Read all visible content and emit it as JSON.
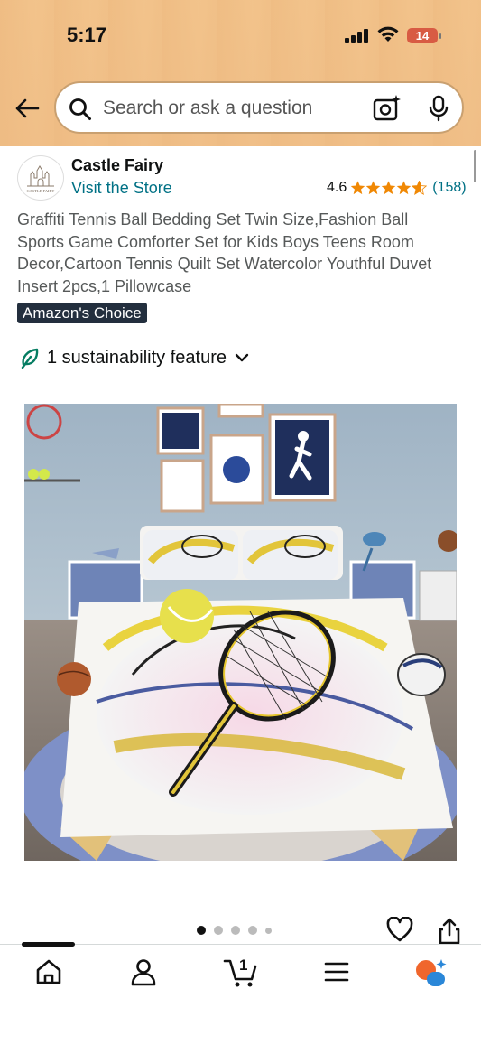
{
  "status_bar": {
    "time": "5:17",
    "battery": "14"
  },
  "search": {
    "placeholder": "Search or ask a question"
  },
  "store": {
    "name": "Castle Fairy",
    "visit_label": "Visit the Store",
    "logo_text": "CASTLE FAIRY"
  },
  "rating": {
    "value": "4.6",
    "count": "(158)",
    "stars": 4.6
  },
  "product": {
    "title": "Graffiti Tennis Ball Bedding Set Twin Size,Fashion Ball Sports Game Comforter Set for Kids Boys Teens Room Decor,Cartoon Tennis Quilt Set Watercolor Youthful Duvet Insert 2pcs,1 Pillowcase",
    "badge": "Amazon's Choice"
  },
  "sustainability": {
    "label": "1 sustainability feature"
  },
  "gallery": {
    "total_dots": 5,
    "active_index": 0
  },
  "cart": {
    "count": "1"
  },
  "colors": {
    "link": "#007185",
    "star": "#f08804",
    "badge_bg": "#232f3e",
    "header": "#efbd85"
  }
}
